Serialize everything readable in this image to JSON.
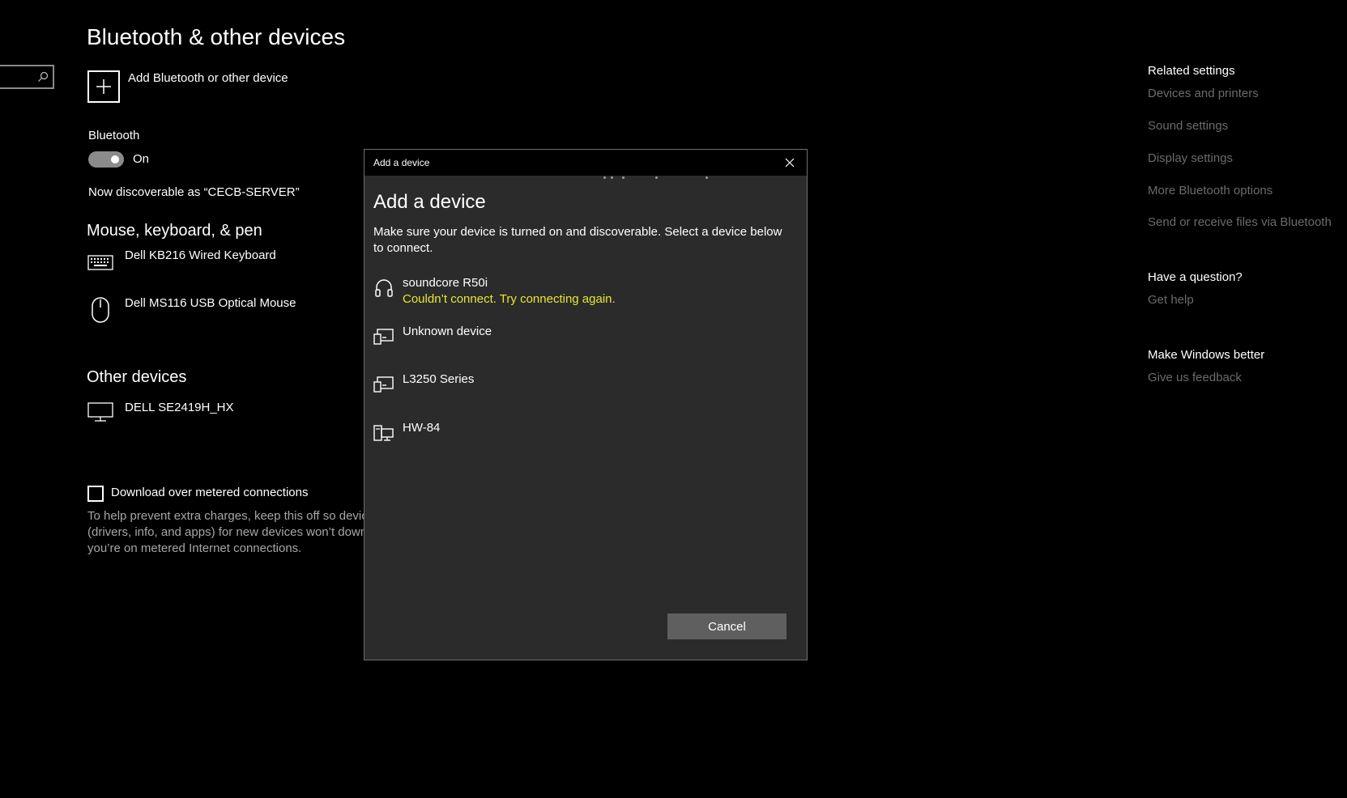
{
  "page": {
    "title": "Bluetooth & other devices",
    "add_device_label": "Add Bluetooth or other device",
    "bluetooth": {
      "label": "Bluetooth",
      "state": "On"
    },
    "discoverable": "Now discoverable as “CECB-SERVER”",
    "mouse_section": {
      "title": "Mouse, keyboard, & pen",
      "devices": [
        {
          "name": "Dell KB216 Wired Keyboard",
          "icon": "keyboard-icon"
        },
        {
          "name": "Dell MS116 USB Optical Mouse",
          "icon": "mouse-icon"
        }
      ]
    },
    "other_section": {
      "title": "Other devices",
      "devices": [
        {
          "name": "DELL SE2419H_HX",
          "icon": "monitor-icon"
        }
      ]
    },
    "metered": {
      "label": "Download over metered connections",
      "checked": false,
      "help_lines": [
        "To help prevent extra charges, keep this off so devic",
        "(drivers, info, and apps) for new devices won’t down",
        "you’re on metered Internet connections."
      ]
    }
  },
  "related": {
    "related_settings": {
      "title": "Related settings",
      "links": [
        "Devices and printers",
        "Sound settings",
        "Display settings",
        "More Bluetooth options",
        "Send or receive files via Bluetooth"
      ]
    },
    "question": {
      "title": "Have a question?",
      "link": "Get help"
    },
    "better": {
      "title": "Make Windows better",
      "link": "Give us feedback"
    }
  },
  "dialog": {
    "window_title": "Add a device",
    "heading": "Add a device",
    "description": "Make sure your device is turned on and discoverable. Select a device below to connect.",
    "devices": [
      {
        "name": "soundcore R50i",
        "status": "Couldn’t connect. Try connecting again.",
        "icon": "headphones-icon"
      },
      {
        "name": "Unknown device",
        "status": "",
        "icon": "device-icon"
      },
      {
        "name": "L3250 Series",
        "status": "",
        "icon": "device-icon"
      },
      {
        "name": "HW-84",
        "status": "",
        "icon": "network-device-icon"
      }
    ],
    "cancel_label": "Cancel",
    "status_color": "#e8e62e"
  }
}
